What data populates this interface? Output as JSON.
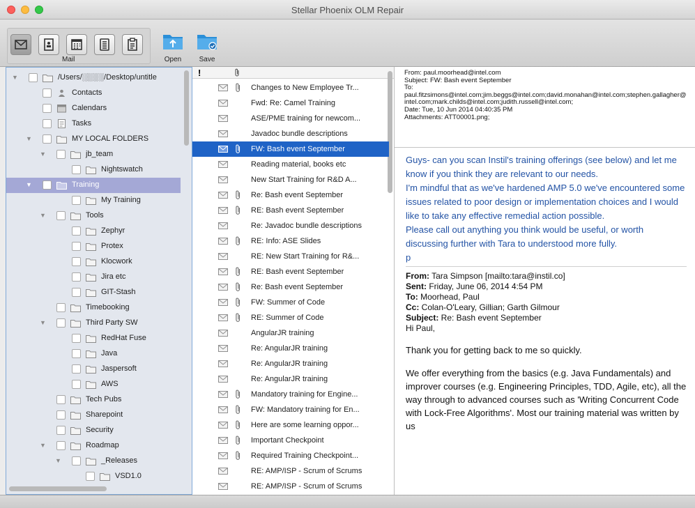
{
  "window": {
    "title": "Stellar Phoenix OLM Repair"
  },
  "toolbar": {
    "mail_label": "Mail",
    "open_label": "Open",
    "save_label": "Save",
    "modes": [
      "mail-icon",
      "contacts-icon",
      "calendar-icon",
      "tasks-icon",
      "notes-icon"
    ]
  },
  "sidebar": {
    "items": [
      {
        "label": "/Users/░░░░/Desktop/untitle",
        "level": 0,
        "expanded": true,
        "icon": "folder-icon"
      },
      {
        "label": "Contacts",
        "level": 1,
        "icon": "contact-icon"
      },
      {
        "label": "Calendars",
        "level": 1,
        "icon": "calendar-icon"
      },
      {
        "label": "Tasks",
        "level": 1,
        "icon": "task-icon"
      },
      {
        "label": "MY LOCAL FOLDERS",
        "level": 1,
        "expanded": true,
        "icon": "folder-icon"
      },
      {
        "label": "jb_team",
        "level": 2,
        "expanded": true,
        "icon": "folder-icon"
      },
      {
        "label": "Nightswatch",
        "level": 3,
        "icon": "folder-icon"
      },
      {
        "label": "Training",
        "level": 1,
        "expanded": true,
        "icon": "folder-icon",
        "selected": true
      },
      {
        "label": "My Training",
        "level": 3,
        "icon": "folder-icon"
      },
      {
        "label": "Tools",
        "level": 2,
        "expanded": true,
        "icon": "folder-icon"
      },
      {
        "label": "Zephyr",
        "level": 3,
        "icon": "folder-icon"
      },
      {
        "label": "Protex",
        "level": 3,
        "icon": "folder-icon"
      },
      {
        "label": "Klocwork",
        "level": 3,
        "icon": "folder-icon"
      },
      {
        "label": "Jira etc",
        "level": 3,
        "icon": "folder-icon"
      },
      {
        "label": "GIT-Stash",
        "level": 3,
        "icon": "folder-icon"
      },
      {
        "label": "Timebooking",
        "level": 2,
        "icon": "folder-icon"
      },
      {
        "label": "Third Party SW",
        "level": 2,
        "expanded": true,
        "icon": "folder-icon"
      },
      {
        "label": "RedHat Fuse",
        "level": 3,
        "icon": "folder-icon"
      },
      {
        "label": "Java",
        "level": 3,
        "icon": "folder-icon"
      },
      {
        "label": "Jaspersoft",
        "level": 3,
        "icon": "folder-icon"
      },
      {
        "label": "AWS",
        "level": 3,
        "icon": "folder-icon"
      },
      {
        "label": "Tech Pubs",
        "level": 2,
        "icon": "folder-icon"
      },
      {
        "label": "Sharepoint",
        "level": 2,
        "icon": "folder-icon"
      },
      {
        "label": "Security",
        "level": 2,
        "icon": "folder-icon"
      },
      {
        "label": "Roadmap",
        "level": 2,
        "expanded": true,
        "icon": "folder-icon"
      },
      {
        "label": "_Releases",
        "level": 3,
        "expanded": true,
        "icon": "folder-icon"
      },
      {
        "label": "VSD1.0",
        "level": 4,
        "icon": "folder-icon"
      }
    ]
  },
  "message_list": {
    "header_flag": "!",
    "messages": [
      {
        "subject": "Changes to New Employee Tr...",
        "attach": true
      },
      {
        "subject": "Fwd: Re: Camel Training",
        "attach": false
      },
      {
        "subject": "ASE/PME training for newcom...",
        "attach": false
      },
      {
        "subject": "Javadoc bundle descriptions",
        "attach": false
      },
      {
        "subject": "FW: Bash event September",
        "attach": true,
        "selected": true
      },
      {
        "subject": "Reading material, books etc",
        "attach": false
      },
      {
        "subject": "New Start Training for R&D A...",
        "attach": false
      },
      {
        "subject": "Re: Bash event September",
        "attach": true
      },
      {
        "subject": "RE: Bash event September",
        "attach": true
      },
      {
        "subject": "Re: Javadoc bundle descriptions",
        "attach": false
      },
      {
        "subject": "RE: Info: ASE Slides",
        "attach": true
      },
      {
        "subject": "RE: New Start Training for R&...",
        "attach": false
      },
      {
        "subject": "RE: Bash event September",
        "attach": true
      },
      {
        "subject": "Re: Bash event September",
        "attach": true
      },
      {
        "subject": "FW: Summer of Code",
        "attach": true
      },
      {
        "subject": "RE: Summer of Code",
        "attach": true
      },
      {
        "subject": "AngularJR training",
        "attach": false
      },
      {
        "subject": "Re: AngularJR training",
        "attach": false
      },
      {
        "subject": "Re: AngularJR training",
        "attach": false
      },
      {
        "subject": "Re: AngularJR training",
        "attach": false
      },
      {
        "subject": "Mandatory training for Engine...",
        "attach": true
      },
      {
        "subject": "FW: Mandatory training for En...",
        "attach": true
      },
      {
        "subject": "Here are some learning oppor...",
        "attach": true
      },
      {
        "subject": "Important Checkpoint",
        "attach": true
      },
      {
        "subject": "Required Training Checkpoint...",
        "attach": true
      },
      {
        "subject": "RE: AMP/ISP - Scrum of Scrums",
        "attach": false
      },
      {
        "subject": "RE: AMP/ISP - Scrum of Scrums",
        "attach": false
      }
    ]
  },
  "reader": {
    "header": {
      "from": "From: paul.moorhead@intel.com",
      "subject": "Subject: FW: Bash event September",
      "to_label": "To:",
      "to": "paul.fitzsimons@intel.com;jim.beggs@intel.com;david.monahan@intel.com;stephen.gallagher@intel.com;mark.childs@intel.com;judith.russell@intel.com;",
      "date": "Date: Tue, 10 Jun 2014 04:40:35 PM",
      "attachments": "Attachments: ATT00001.png;"
    },
    "blue_paragraphs": [
      "Guys- can you scan Instil's training offerings (see below) and let me know if you think they are relevant to our needs.",
      "I'm mindful that as we've hardened AMP 5.0 we've encountered some issues related to poor design or implementation choices and I would like to take any effective remedial action possible.",
      "Please call out anything you think would be useful, or worth discussing further with Tara to understood more fully.",
      "p"
    ],
    "quoted": {
      "from_label": "From:",
      "from": " Tara Simpson [mailto:tara@instil.co]",
      "sent_label": "Sent:",
      "sent": " Friday, June 06, 2014 4:54 PM",
      "to_label": "To:",
      "to": " Moorhead, Paul",
      "cc_label": "Cc:",
      "cc": " Colan-O'Leary, Gillian; Garth Gilmour",
      "subject_label": "Subject:",
      "subject": " Re: Bash event September",
      "greeting": "Hi Paul,"
    },
    "paragraphs": [
      "Thank you for getting back to me so quickly.",
      "We offer everything from the basics (e.g. Java Fundamentals) and improver courses (e.g. Engineering Principles, TDD, Agile, etc), all the way through to advanced courses such as 'Writing Concurrent Code with Lock-Free Algorithms'. Most our training material was written by us"
    ]
  },
  "colors": {
    "selection_blue": "#1f63c6",
    "sidebar_selection": "#a4a8d6",
    "body_blue_text": "#2353a5",
    "folder_blue": "#2b8fd8"
  }
}
